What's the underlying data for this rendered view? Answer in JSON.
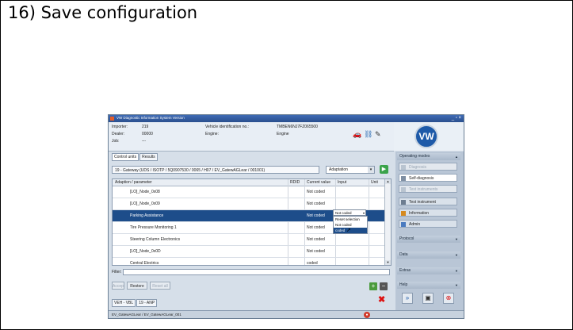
{
  "heading": "16) Save configuration",
  "window": {
    "title": "VW Diagnostic Information System Version",
    "controls": "_ ▫ ×"
  },
  "info": {
    "importer_label": "Importer:",
    "importer_value": "219",
    "dealer_label": "Dealer:",
    "dealer_value": "00000",
    "job_label": "Job:",
    "job_value": "---",
    "vin_label": "Vehicle identification no.:",
    "vin_value": "TMBEN6NJ7FZ065500",
    "engine_label": "Engine:",
    "engine_value": "Engine"
  },
  "logo": "VW",
  "tabs": [
    "Control units",
    "Results"
  ],
  "control_unit_path": "19 - Gateway (UDS / ISOTP / 5Q0907530 / 0065 / H07 / EV_GatewAGLear / 001001)",
  "function_select": {
    "value": "Adaptation",
    "arrow": "▾"
  },
  "go_button": "▶",
  "table": {
    "headers": [
      "Adaption / parameter",
      "RDID",
      "Current value",
      "Input",
      "Unit"
    ],
    "rows": [
      {
        "name": "[LO]_Node_0x08",
        "value": "Not coded"
      },
      {
        "name": "[LO]_Node_0x09",
        "value": "Not coded"
      },
      {
        "name": "Parking Assistance",
        "value": "Not coded"
      },
      {
        "name": "Tire Pressure Monitoring 1",
        "value": "Not coded"
      },
      {
        "name": "Steering Column Electronics",
        "value": "Not coded"
      },
      {
        "name": "[LO]_Node_0x0D",
        "value": "Not coded"
      },
      {
        "name": "Central Electrics",
        "value": "coded"
      }
    ]
  },
  "dropdown": {
    "selected": "Not coded",
    "arrow": "▾",
    "options": [
      "Reset selection",
      "Not coded",
      "coded"
    ],
    "highlighted_index": 2
  },
  "filter_label": "Filter:",
  "bottom_buttons": [
    "Accept",
    "Restore",
    "Reset all"
  ],
  "plus_label": "+",
  "minus_label": "−",
  "vehicle_tabs": [
    "VEH - VBL",
    "19 - ANP"
  ],
  "status_text": "EV_GatewAGLear / EV_GatewAGLear_001",
  "right_panel": {
    "operating_modes": "Operating modes",
    "items": [
      {
        "label": "Diagnosis",
        "state": "disabled"
      },
      {
        "label": "Self-diagnosis",
        "state": "active"
      },
      {
        "label": "Test instruments",
        "state": "disabled"
      },
      {
        "label": "Test instrument",
        "state": "normal"
      },
      {
        "label": "Information",
        "state": "normal"
      },
      {
        "label": "Admin",
        "state": "normal"
      }
    ],
    "sections": [
      "Protocol",
      "Data",
      "Extras",
      "Help"
    ]
  },
  "colors": {
    "selection": "#1d4d8a",
    "accent": "#1e5aa8",
    "danger": "#d11111",
    "ok": "#3aa34a"
  }
}
